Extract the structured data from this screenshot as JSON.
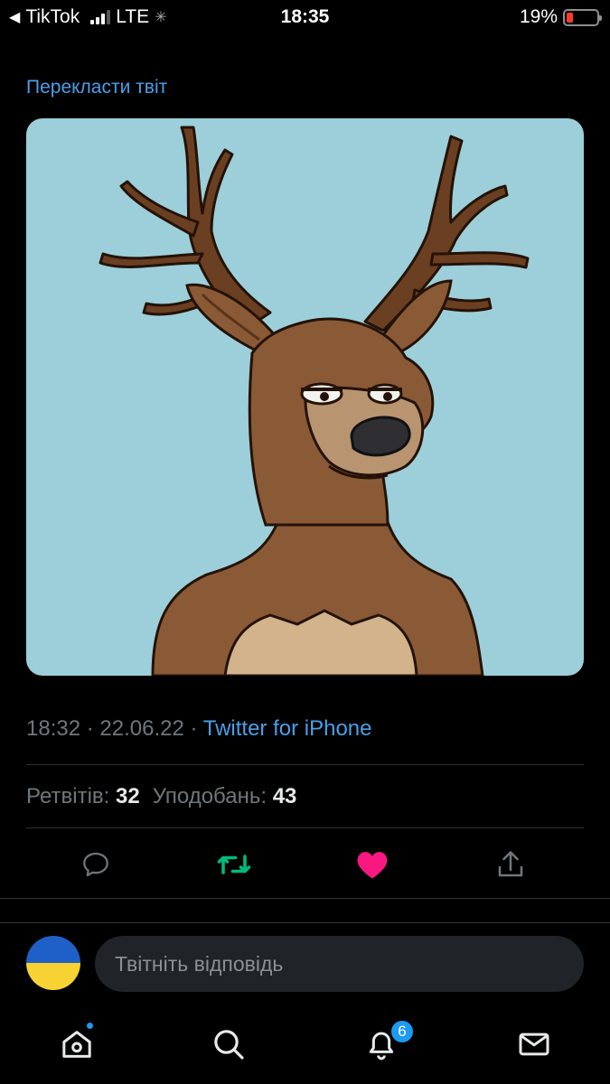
{
  "status_bar": {
    "back_app": "TikTok",
    "network": "LTE",
    "time": "18:35",
    "battery": "19%"
  },
  "tweet": {
    "translate_link": "Перекласти твіт",
    "media": {
      "description_icon": "deer-nft-illustration",
      "background": "#9ccfd9"
    },
    "time": "18:32",
    "date": "22.06.22",
    "separator": "·",
    "source": "Twitter for iPhone",
    "retweets_label": "Ретвітів:",
    "retweets_count": "32",
    "likes_label": "Уподобань:",
    "likes_count": "43",
    "liked": true
  },
  "actions": {
    "reply_icon": "comment-icon",
    "retweet_icon": "retweet-icon",
    "like_icon": "heart-icon",
    "share_icon": "share-icon"
  },
  "composer": {
    "placeholder": "Твітніть відповідь",
    "avatar": "ukraine-flag-avatar"
  },
  "tabbar": {
    "items": [
      "home-icon",
      "search-icon",
      "notifications-icon",
      "messages-icon"
    ],
    "notifications_badge": "6"
  },
  "colors": {
    "accent": "#1d9bf0",
    "link": "#4a9fe8",
    "like": "#f91880",
    "retweet": "#00ba7c"
  }
}
